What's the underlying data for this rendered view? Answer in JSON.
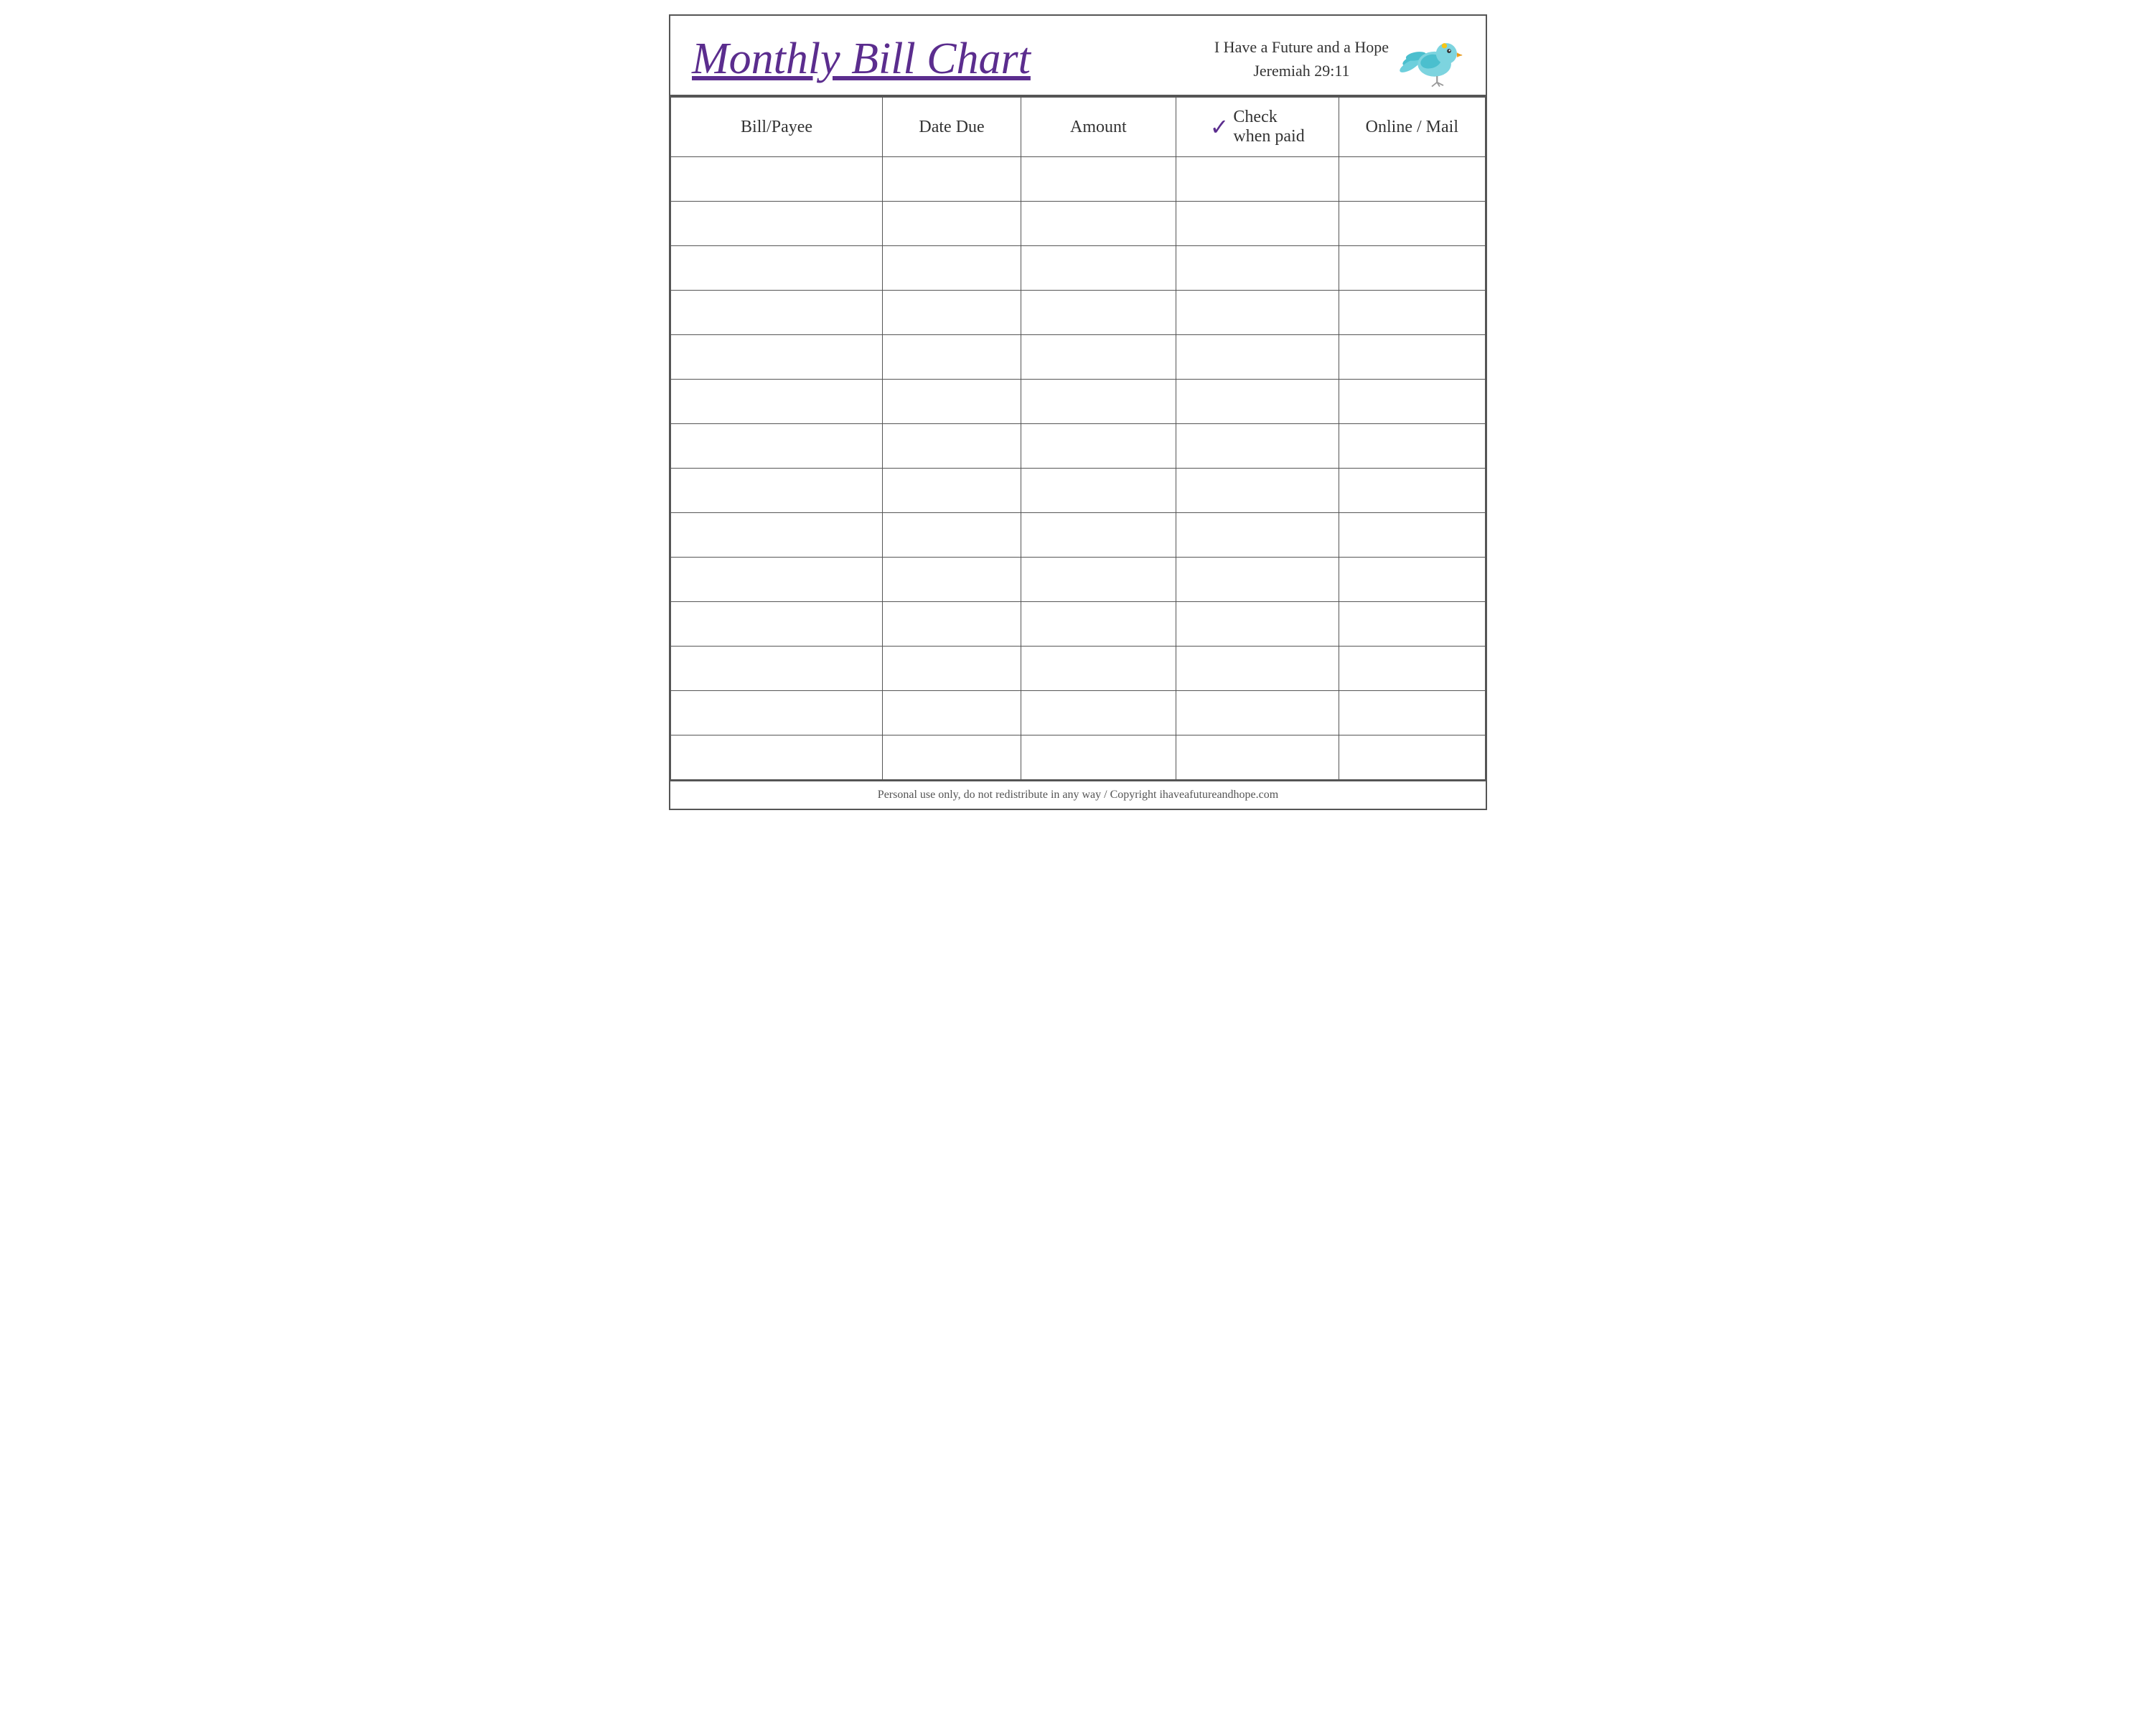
{
  "header": {
    "title": "Monthly Bill Chart",
    "subtitle_line1": "I Have a Future and a Hope",
    "subtitle_line2": "Jeremiah 29:11"
  },
  "table": {
    "columns": [
      {
        "key": "bill_payee",
        "label": "Bill/Payee"
      },
      {
        "key": "date_due",
        "label": "Date Due"
      },
      {
        "key": "amount",
        "label": "Amount"
      },
      {
        "key": "check_when_paid",
        "label_check": "Check",
        "label_when_paid": "when paid"
      },
      {
        "key": "online_mail",
        "label": "Online / Mail"
      }
    ],
    "row_count": 14
  },
  "footer": {
    "text": "Personal use only, do not redistribute in any way / Copyright ihaveafutureandhope.com"
  }
}
